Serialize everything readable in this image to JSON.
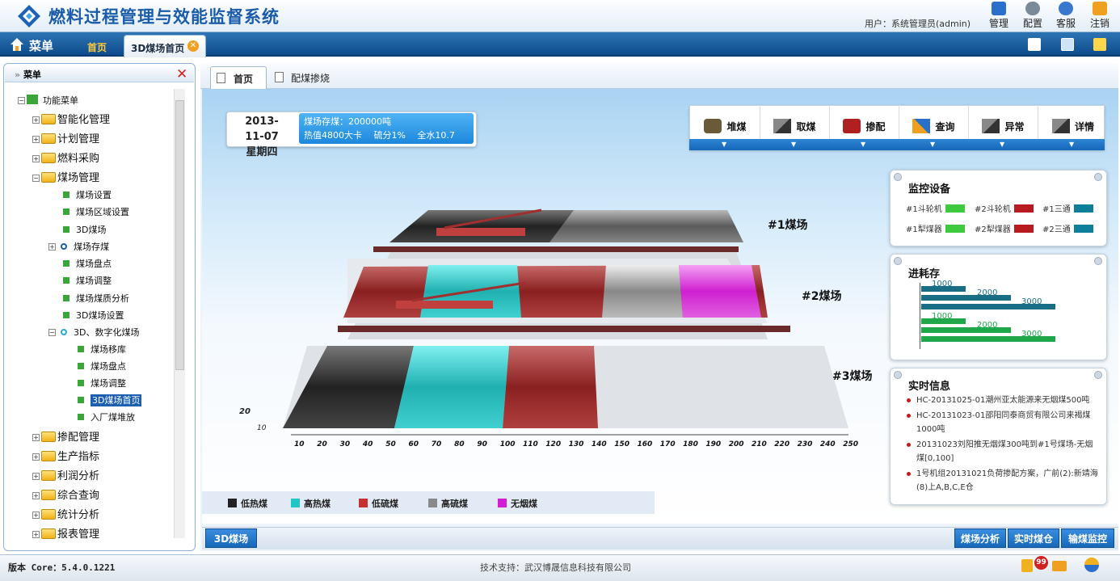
{
  "header": {
    "title": "燃料过程管理与效能监督系统",
    "user": "用户：系统管理员(admin)",
    "buttons": [
      {
        "label": "管理",
        "icon": "monitor-icon",
        "color": "#2a6fc9"
      },
      {
        "label": "配置",
        "icon": "gears-icon",
        "color": "#7a8a98"
      },
      {
        "label": "客服",
        "icon": "support-icon",
        "color": "#3a78d0"
      },
      {
        "label": "注销",
        "icon": "logout-icon",
        "color": "#f0a020"
      }
    ]
  },
  "nav": {
    "menu": "菜单",
    "home_tab": "首页",
    "active_tab": "3D煤场首页",
    "close_glyph": "✕"
  },
  "sidebar": {
    "header": "菜单",
    "tree_root": "功能菜单",
    "items": [
      {
        "label": "智能化管理"
      },
      {
        "label": "计划管理"
      },
      {
        "label": "燃料采购"
      },
      {
        "label": "煤场管理"
      },
      {
        "label": "煤场设置"
      },
      {
        "label": "煤场区域设置"
      },
      {
        "label": "3D煤场"
      },
      {
        "label": "煤场存煤"
      },
      {
        "label": "煤场盘点"
      },
      {
        "label": "煤场调整"
      },
      {
        "label": "煤场煤质分析"
      },
      {
        "label": "3D煤场设置"
      },
      {
        "label": "3D、数字化煤场"
      },
      {
        "label": "煤场移库"
      },
      {
        "label": "煤场盘点"
      },
      {
        "label": "煤场调整"
      },
      {
        "label": "3D煤场首页"
      },
      {
        "label": "入厂煤堆放"
      },
      {
        "label": "掺配管理"
      },
      {
        "label": "生产指标"
      },
      {
        "label": "利润分析"
      },
      {
        "label": "综合查询"
      },
      {
        "label": "统计分析"
      },
      {
        "label": "报表管理"
      }
    ]
  },
  "content_tabs": {
    "home": "首页",
    "blend": "配煤掺烧"
  },
  "info": {
    "date": "2013-11-07",
    "weekday": "星期四",
    "stock": "煤场存煤：200000吨",
    "quality": "热值4800大卡　 硫分1%　 全水10.7"
  },
  "actions": [
    {
      "label": "堆煤",
      "icon": "stack-coal-icon"
    },
    {
      "label": "取煤",
      "icon": "reclaim-coal-icon"
    },
    {
      "label": "掺配",
      "icon": "blend-icon"
    },
    {
      "label": "查询",
      "icon": "query-icon"
    },
    {
      "label": "异常",
      "icon": "alert-icon"
    },
    {
      "label": "详情",
      "icon": "details-icon"
    }
  ],
  "yards": {
    "y1": "#1煤场",
    "y2": "#2煤场",
    "y3": "#3煤场"
  },
  "axis": {
    "ticks": [
      "10",
      "20",
      "30",
      "40",
      "50",
      "60",
      "70",
      "80",
      "90",
      "100",
      "110",
      "120",
      "130",
      "140",
      "150",
      "160",
      "170",
      "180",
      "190",
      "200",
      "210",
      "220",
      "230",
      "240",
      "250"
    ],
    "depth1": "20",
    "depth2": "10"
  },
  "monitor": {
    "title": "监控设备",
    "items": [
      {
        "label": "#1斗轮机",
        "color": "#3ec93e"
      },
      {
        "label": "#2斗轮机",
        "color": "#b81a22"
      },
      {
        "label": "#1三通",
        "color": "#0e7f9a"
      },
      {
        "label": "#1犁煤器",
        "color": "#3ec93e"
      },
      {
        "label": "#2犁煤器",
        "color": "#b81a22"
      },
      {
        "label": "#2三通",
        "color": "#0e7f9a"
      }
    ]
  },
  "inventory": {
    "title": "进耗存",
    "bars": [
      {
        "value": 1000,
        "label": "1000",
        "color": "#196e86"
      },
      {
        "value": 2000,
        "label": "2000",
        "color": "#196e86"
      },
      {
        "value": 3000,
        "label": "3000",
        "color": "#196e86"
      },
      {
        "value": 1000,
        "label": "1000",
        "color": "#1fa84a"
      },
      {
        "value": 2000,
        "label": "2000",
        "color": "#1fa84a"
      },
      {
        "value": 3000,
        "label": "3000",
        "color": "#1fa84a"
      }
    ]
  },
  "realtime": {
    "title": "实时信息",
    "lines": [
      "HC-20131025-01潮州亚太能源来无烟煤500吨",
      "HC-20131023-01邵阳同泰商贸有限公司来褐煤1000吨",
      "20131023刘阳推无烟煤300吨到#1号煤场-无烟煤[0,100]",
      "1号机组20131021负荷掺配方案，广前(2):新靖海(8)上A,B,C,E仓"
    ]
  },
  "legend": [
    {
      "label": "低热煤",
      "color": "#222222"
    },
    {
      "label": "高热煤",
      "color": "#22c4c4"
    },
    {
      "label": "低硫煤",
      "color": "#c83030"
    },
    {
      "label": "高硫煤",
      "color": "#8a8a8a"
    },
    {
      "label": "无烟煤",
      "color": "#d21ed2"
    }
  ],
  "bottom": {
    "left": "3D煤场",
    "right": [
      "煤场分析",
      "实时煤仓",
      "输煤监控"
    ]
  },
  "footer": {
    "version": "版本 Core：5.4.0.1221",
    "support": "技术支持：武汉博晟信息科技有限公司",
    "badge": "99"
  }
}
